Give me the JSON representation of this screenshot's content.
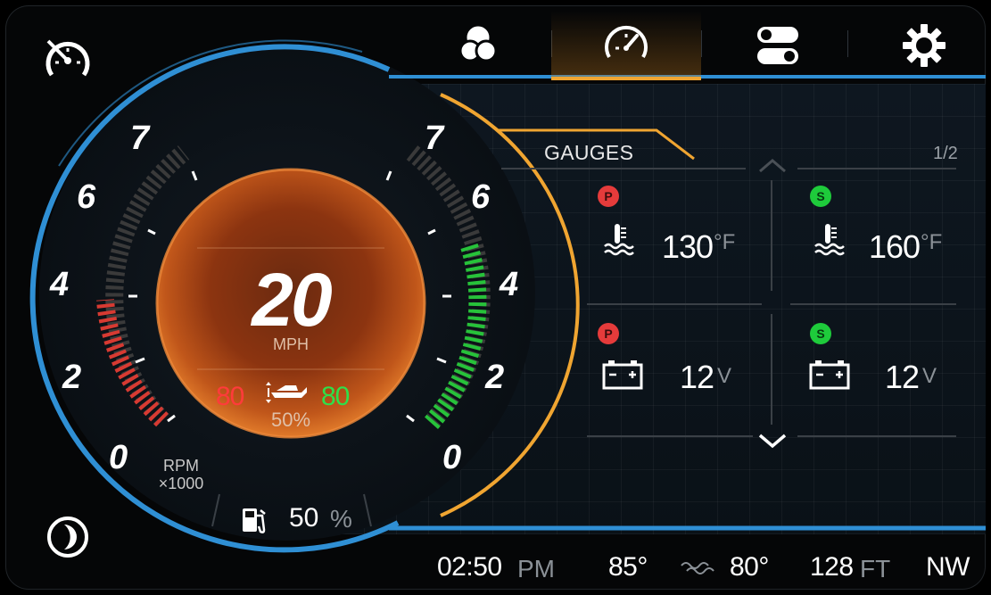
{
  "tabs": [
    {
      "name": "tab-color",
      "icon": "color-circles-icon",
      "active": false
    },
    {
      "name": "tab-gauges",
      "icon": "gauge-icon",
      "active": true
    },
    {
      "name": "tab-toggles",
      "icon": "toggle-switches-icon",
      "active": false
    },
    {
      "name": "tab-settings",
      "icon": "gear-icon",
      "active": false
    }
  ],
  "top_left_icon": "speedometer-icon",
  "bottom_left_icon": "night-mode-moon-icon",
  "speed": {
    "value": "20",
    "unit": "MPH"
  },
  "rpm_scale_left": [
    "0",
    "2",
    "4",
    "6",
    "7"
  ],
  "rpm_scale_right": [
    "0",
    "2",
    "4",
    "6",
    "7"
  ],
  "rpm_label": "RPM",
  "rpm_multiplier": "×1000",
  "trim": {
    "port": "80",
    "starboard": "80",
    "percent": "50%",
    "icon": "boat-trim-icon"
  },
  "fuel": {
    "icon": "fuel-pump-icon",
    "value": "50",
    "unit": "%"
  },
  "gauges": {
    "title": "GAUGES",
    "page": "1/2",
    "cells": [
      {
        "badge": "P",
        "icon": "coolant-temp-icon",
        "value": "130",
        "unit": "°F"
      },
      {
        "badge": "S",
        "icon": "coolant-temp-icon",
        "value": "160",
        "unit": "°F"
      },
      {
        "badge": "P",
        "icon": "battery-icon",
        "value": "12",
        "unit": "V"
      },
      {
        "badge": "S",
        "icon": "battery-icon",
        "value": "12",
        "unit": "V"
      }
    ]
  },
  "status_bar": {
    "time": "02:50",
    "ampm": "PM",
    "air_temp": "85°",
    "water_icon": "water-temp-icon",
    "water_temp": "80°",
    "depth": "128",
    "depth_unit": "FT",
    "heading": "NW"
  },
  "colors": {
    "accent": "#f0a531",
    "blue_arc": "#2f8fd4",
    "port": "#e53b3b",
    "starboard": "#1ecb3b"
  }
}
